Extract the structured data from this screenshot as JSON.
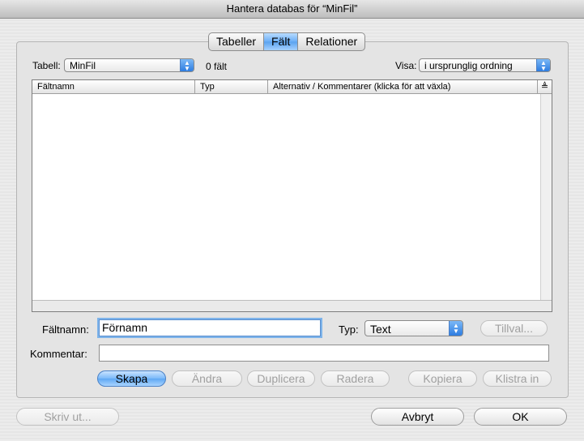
{
  "window": {
    "title": "Hantera databas för “MinFil”"
  },
  "tabs": [
    {
      "label": "Tabeller",
      "active": false
    },
    {
      "label": "Fält",
      "active": true
    },
    {
      "label": "Relationer",
      "active": false
    }
  ],
  "table_selector": {
    "label": "Tabell:",
    "value": "MinFil",
    "field_count": "0 fält"
  },
  "view_selector": {
    "label": "Visa:",
    "value": "i ursprunglig ordning"
  },
  "field_list": {
    "columns": [
      "Fältnamn",
      "Typ",
      "Alternativ / Kommentarer (klicka för att växla)"
    ],
    "rows": []
  },
  "field_form": {
    "name_label": "Fältnamn:",
    "name_value": "Förnamn",
    "type_label": "Typ:",
    "type_value": "Text",
    "options_button": "Tillval...",
    "comment_label": "Kommentar:",
    "comment_value": ""
  },
  "actions": {
    "create": "Skapa",
    "change": "Ändra",
    "duplicate": "Duplicera",
    "delete": "Radera",
    "copy": "Kopiera",
    "paste": "Klistra in"
  },
  "footer": {
    "print": "Skriv ut...",
    "cancel": "Avbryt",
    "ok": "OK"
  },
  "colors": {
    "accent": "#5aa2ef",
    "disabled_text": "#a0a0a0"
  }
}
